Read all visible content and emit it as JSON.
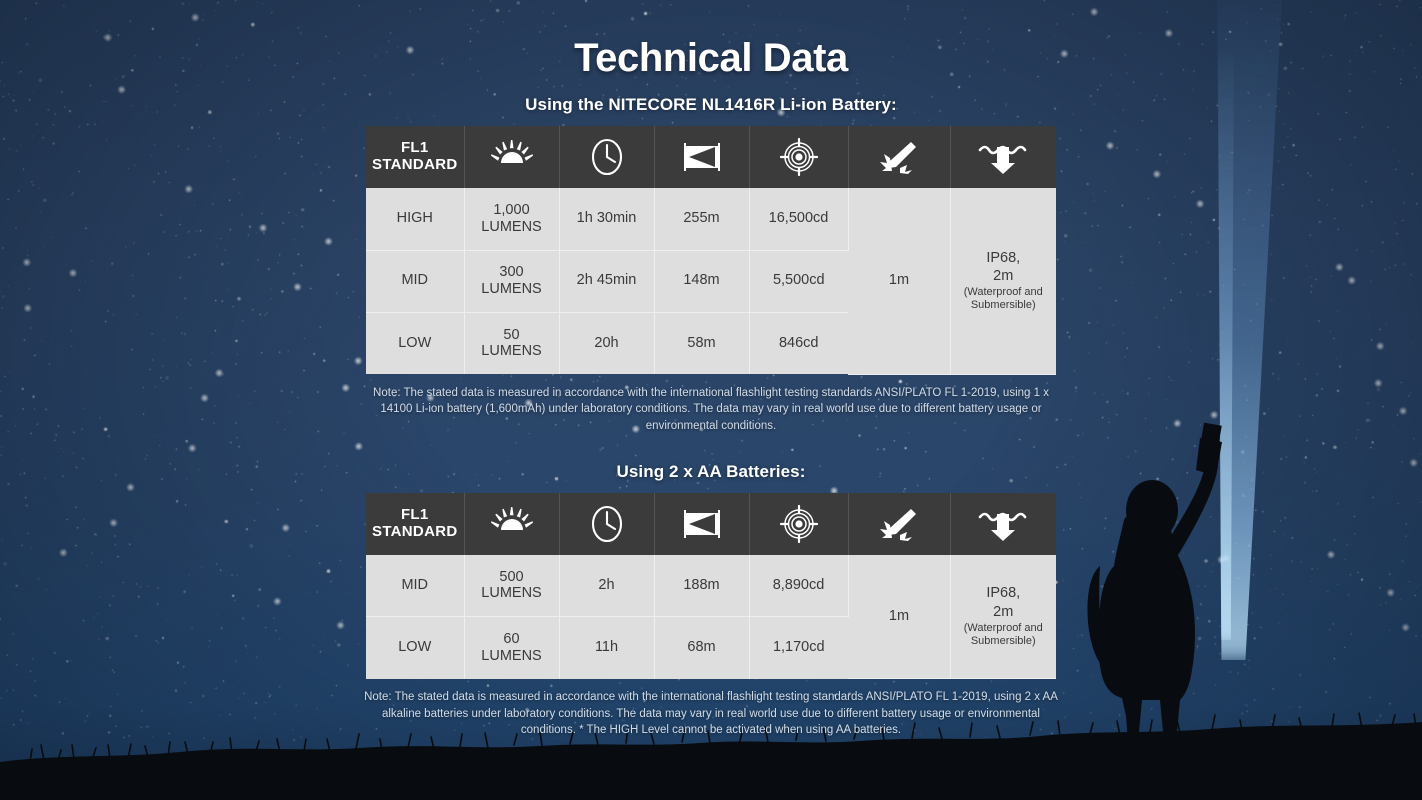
{
  "page": {
    "title": "Technical Data",
    "background_sky_color": "#2c4567",
    "beam_color": "#8fc6ff",
    "silhouette_color": "#090d12"
  },
  "header_columns": [
    {
      "id": "fl1-standard",
      "label_line1": "FL1",
      "label_line2": "STANDARD",
      "icon": ""
    },
    {
      "id": "lumens",
      "label_line1": "",
      "label_line2": "",
      "icon": "sunburst-lumens-icon"
    },
    {
      "id": "runtime",
      "label_line1": "",
      "label_line2": "",
      "icon": "clock-runtime-icon"
    },
    {
      "id": "beam-distance",
      "label_line1": "",
      "label_line2": "",
      "icon": "beam-distance-icon"
    },
    {
      "id": "peak-intensity",
      "label_line1": "",
      "label_line2": "",
      "icon": "target-peak-intensity-icon"
    },
    {
      "id": "impact-resistance",
      "label_line1": "",
      "label_line2": "",
      "icon": "impact-resistance-icon"
    },
    {
      "id": "water-resistance",
      "label_line1": "",
      "label_line2": "",
      "icon": "water-resistance-icon"
    }
  ],
  "sections": [
    {
      "id": "li-ion",
      "title": "Using the NITECORE NL1416R Li-ion Battery:",
      "rows": [
        {
          "mode": "HIGH",
          "lumens_num": "1,000",
          "lumens_word": "LUMENS",
          "runtime": "1h 30min",
          "distance": "255m",
          "intensity": "16,500cd"
        },
        {
          "mode": "MID",
          "lumens_num": "300",
          "lumens_word": "LUMENS",
          "runtime": "2h 45min",
          "distance": "148m",
          "intensity": "5,500cd"
        },
        {
          "mode": "LOW",
          "lumens_num": "50",
          "lumens_word": "LUMENS",
          "runtime": "20h",
          "distance": "58m",
          "intensity": "846cd"
        }
      ],
      "impact": "1m",
      "water_main_line1": "IP68,",
      "water_main_line2": "2m",
      "water_sub": "(Waterproof and Submersible)",
      "note": "Note: The stated data is measured in accordance with the international flashlight testing standards ANSI/PLATO FL 1-2019, using 1 x 14100 Li-ion battery (1,600mAh) under laboratory conditions. The data may vary in real world use due to different battery usage or environmental conditions."
    },
    {
      "id": "aa",
      "title": "Using 2 x AA Batteries:",
      "rows": [
        {
          "mode": "MID",
          "lumens_num": "500",
          "lumens_word": "LUMENS",
          "runtime": "2h",
          "distance": "188m",
          "intensity": "8,890cd"
        },
        {
          "mode": "LOW",
          "lumens_num": "60",
          "lumens_word": "LUMENS",
          "runtime": "11h",
          "distance": "68m",
          "intensity": "1,170cd"
        }
      ],
      "impact": "1m",
      "water_main_line1": "IP68,",
      "water_main_line2": "2m",
      "water_sub": "(Waterproof and Submersible)",
      "note": "Note: The stated data is measured in accordance with the international flashlight testing standards ANSI/PLATO FL 1-2019, using 2 x AA alkaline batteries under laboratory conditions. The data may vary in real world use due to different battery usage or environmental conditions. * The HIGH Level cannot be activated when using AA batteries."
    }
  ]
}
